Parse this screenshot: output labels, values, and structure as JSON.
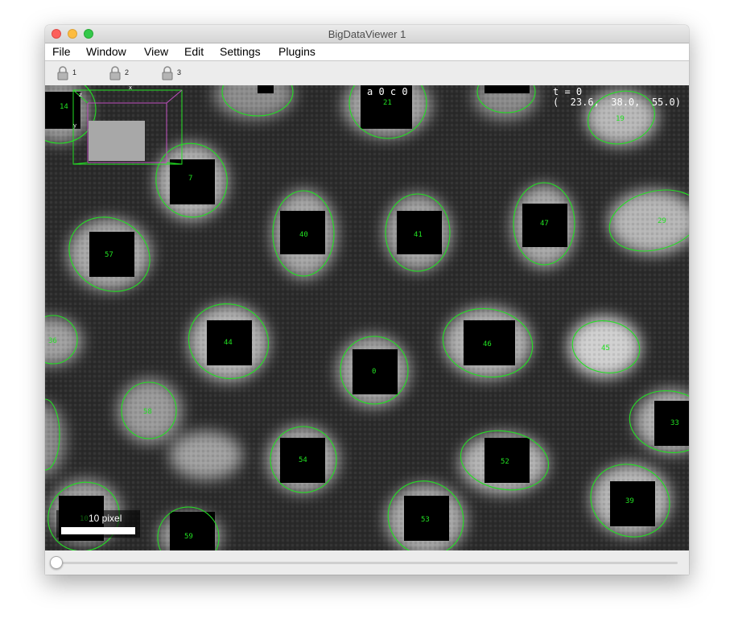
{
  "window": {
    "title": "BigDataViewer 1"
  },
  "menu": [
    "File",
    "Window",
    "View",
    "Edit",
    "Settings",
    "Plugins"
  ],
  "toolbar": {
    "locks": [
      "1",
      "2",
      "3"
    ]
  },
  "viewer": {
    "source_label": "a 0 c 0",
    "time_label": "t = 0",
    "coords_label": "(  23.6,  38.0,  55.0)",
    "scalebar_label": "10 pixel",
    "axis_x": "x",
    "axis_y": "y",
    "axis_z": "z",
    "annotation_color": "#22e022",
    "labels": [
      "14",
      "21",
      "19",
      "7",
      "40",
      "41",
      "47",
      "29",
      "57",
      "44",
      "46",
      "45",
      "0",
      "36",
      "58",
      "33",
      "54",
      "52",
      "10",
      "59",
      "53",
      "39"
    ]
  },
  "timeline": {
    "position": 0
  }
}
